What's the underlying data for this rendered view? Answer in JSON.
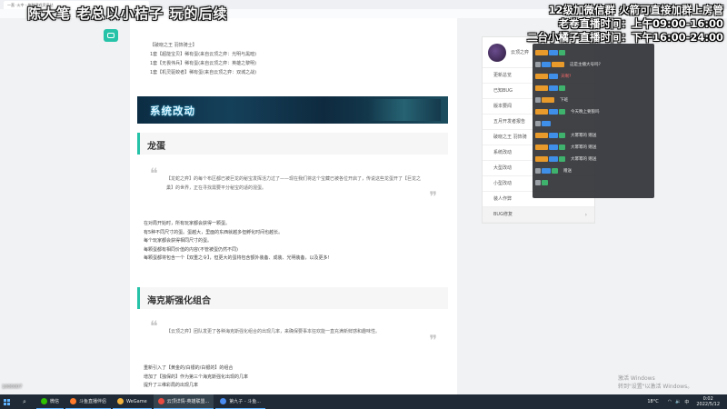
{
  "browser": {
    "tab_title": "一直 ·火中 - 各种游戏资讯站"
  },
  "overlay": {
    "left_title": "陈大笔 老总以小桔子 玩的后续",
    "info_lines": [
      "12级加微信群 火箭可直接加群上房管",
      "老卷直播时间：上午09:00-16:00",
      "二台小橘子直播时间：下午16:00-24:00"
    ]
  },
  "article": {
    "hero_list": [
      "【破晓之王 羽饰骑士】",
      "1套【超能宝贝】稀有蛋(来自云顶之弈：光明与黑暗)",
      "1套【无畏伟兵】稀有蛋(来自云顶之弈：英雄之黎明)",
      "1套【机灵驱蛟者】稀有蛋(来自云顶之弈：双城之战)"
    ],
    "banner_title": "系统改动",
    "section1_title": "龙蛋",
    "section1_quote": "【龙蛇之弈】的每个布区都已被巨龙的秘宝发挥活力过了——现在我们将这个宝藏已被各位开启了，传说这些龙蛋开了【巨龙之巢】的世界，正在寻找需要平分秘宝的适的混蛋。",
    "section1_body": [
      "在对局开始时，所有玩家都会获得一颗蛋。",
      "有5种不同尺寸的蛋。蛋越大，里面的东西就越多但孵化时间也越长。",
      "每个玩家都会获得相同尺寸的蛋。",
      "每颗蛋都有相同价值的内容(不管被蛋仍然不同)",
      "每颗蛋都将包含一个【双重之令】，但更大的蛋将包含额外装备、成装、光明装备，以及更多!"
    ],
    "section2_title": "海克斯强化组合",
    "section2_quote": "【云顶之弈】团队发更了各种海克斯强化组合的出现几率，来确保要事本狂欢能一直充满新鲜感和趣味性。",
    "section2_body": [
      "重新引入了【黄金的/白银的/白银的】的组合",
      "增加了【独保的】作为第三个海克斯强化出现的几率",
      "提升了三维彩局的出现几率"
    ]
  },
  "side_nav": {
    "header_label": "云顶之弈",
    "items": [
      {
        "label": "更新总览"
      },
      {
        "label": "已知BUG"
      },
      {
        "label": "版本要闻"
      },
      {
        "label": "五月开发者报告"
      },
      {
        "label": "破晓之王 羽饰骑"
      },
      {
        "label": "系统改动"
      },
      {
        "label": "大型改动"
      },
      {
        "label": "小型改动"
      },
      {
        "label": "装人作弊"
      },
      {
        "label": "BUG修复"
      }
    ]
  },
  "chat": {
    "messages": [
      {
        "name": "",
        "text": "",
        "red": false
      },
      {
        "name": "",
        "text": "这是主播大号吗?",
        "red": false
      },
      {
        "name": "天啊?",
        "text": "",
        "red": true
      },
      {
        "name": "",
        "text": "",
        "red": false
      },
      {
        "name": "",
        "text": "下班",
        "red": false
      },
      {
        "name": "",
        "text": "今天晚上要狼吗",
        "red": false
      },
      {
        "name": "",
        "text": "",
        "red": false
      },
      {
        "name": "",
        "text": "大幂幂的 赠送",
        "red": true
      },
      {
        "name": "",
        "text": "大幂幂的 赠送",
        "red": true
      },
      {
        "name": "",
        "text": "大幂幂的 赠送",
        "red": true
      },
      {
        "name": "",
        "text": "赠送",
        "red": false
      },
      {
        "name": "",
        "text": "",
        "red": false
      }
    ]
  },
  "watermark": {
    "line1": "激活 Windows",
    "line2": "转到\"设置\"以激活 Windows。"
  },
  "taskbar": {
    "apps": [
      {
        "label": "微信",
        "color": "#2dc100",
        "active": false
      },
      {
        "label": "斗鱼直播伴侣",
        "color": "#ff7a2b",
        "active": false
      },
      {
        "label": "WeGame",
        "color": "#f2b13b",
        "active": false
      },
      {
        "label": "云顶详情-英雄联盟...",
        "color": "#e84a3f",
        "active": true
      },
      {
        "label": "第九子 - 斗鱼...",
        "color": "#4a8cf0",
        "active": false
      }
    ],
    "temperature": "18°C",
    "time": "0:02",
    "date": "2022/5/12"
  },
  "stream_corner": "1000007"
}
